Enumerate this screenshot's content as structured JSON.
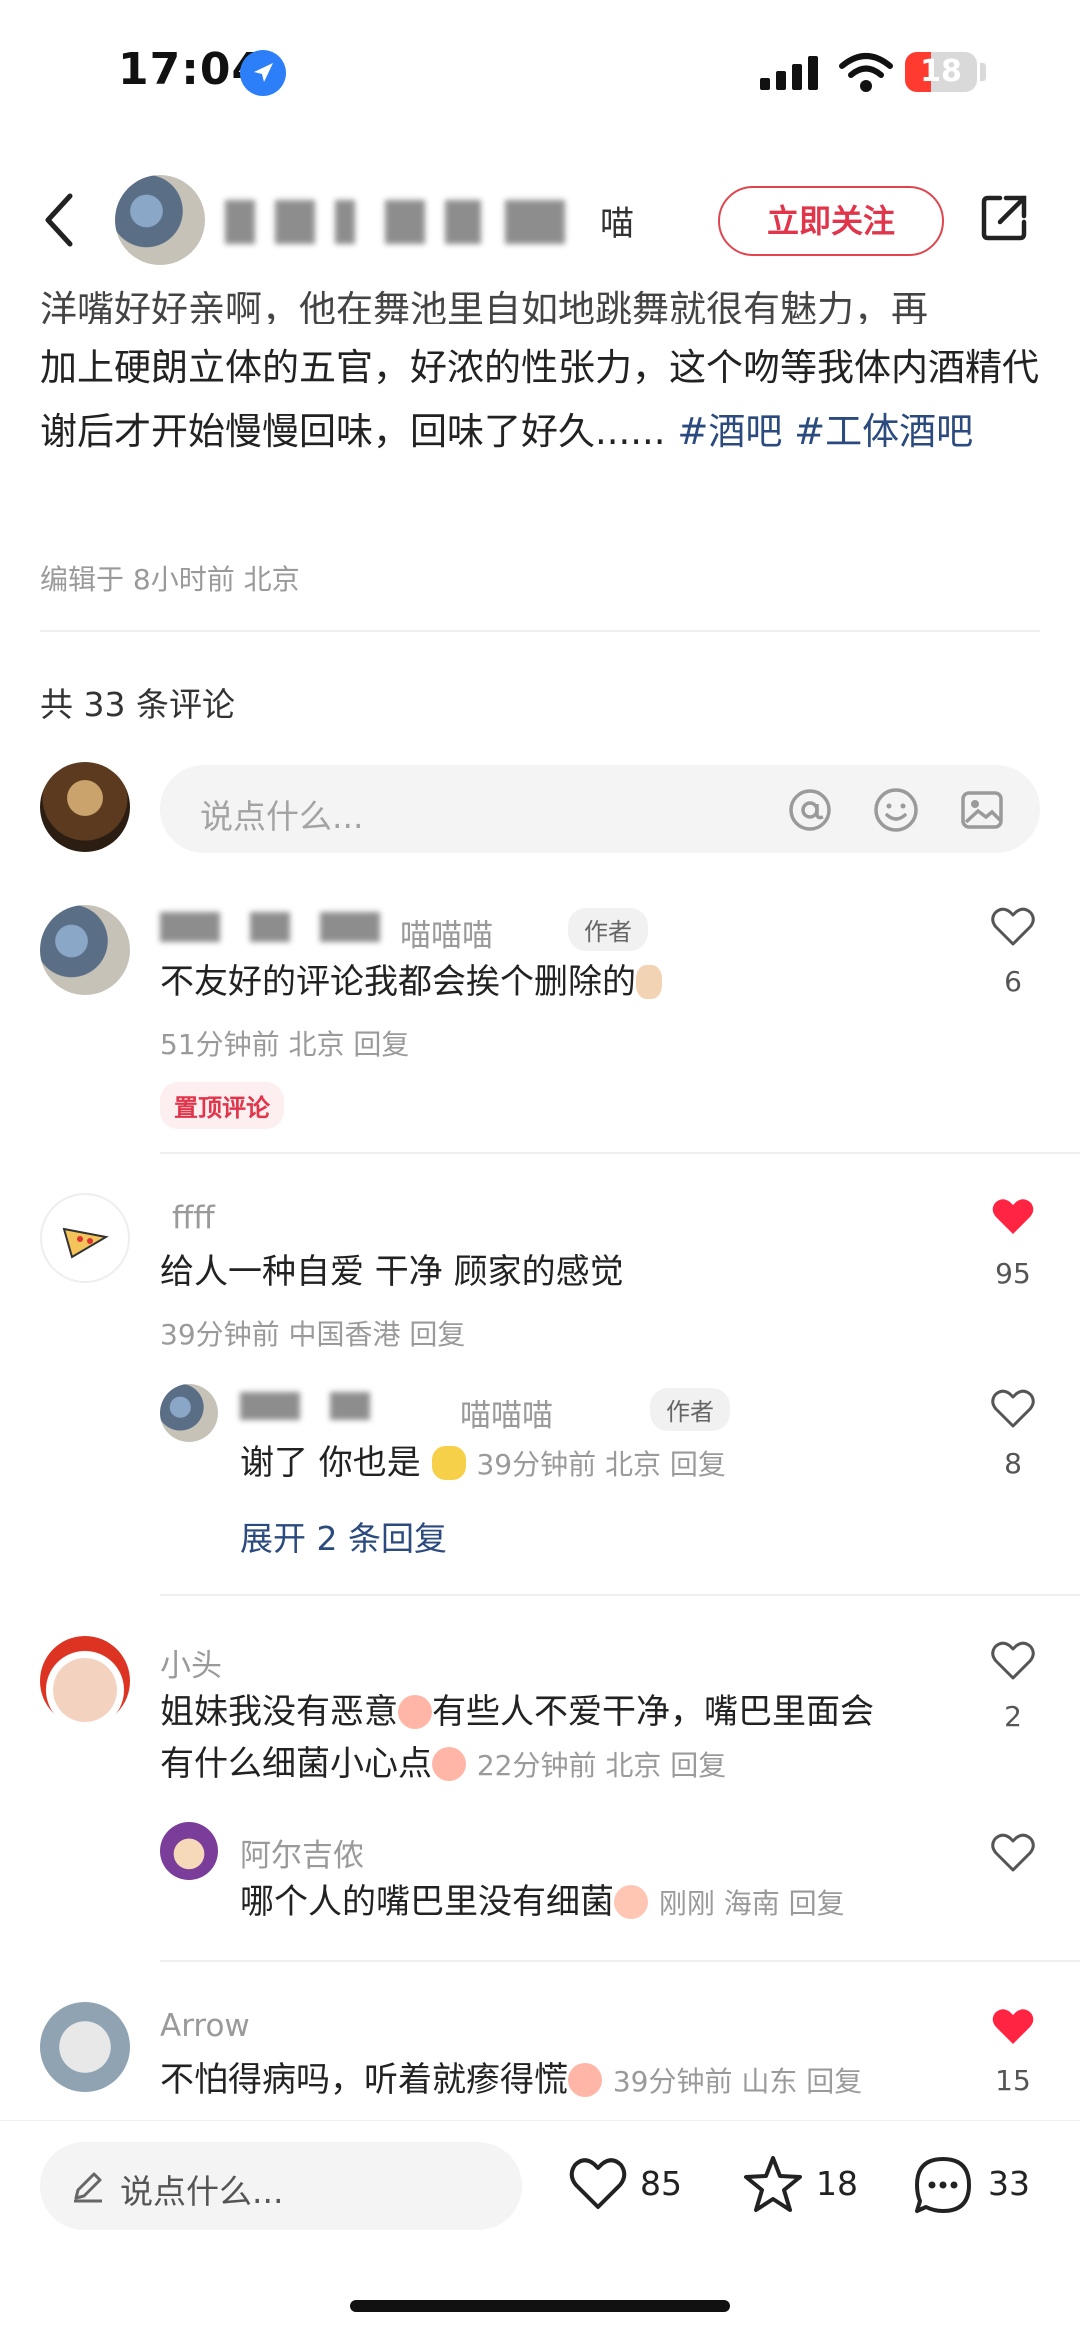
{
  "status_bar": {
    "time": "17:04",
    "battery": "18"
  },
  "header": {
    "name_tail": "喵",
    "follow_label": "立即关注"
  },
  "post": {
    "cut_line": "洋嘴好好亲啊，他在舞池里自如地跳舞就很有魅力，再",
    "line_main": "加上硬朗立体的五官，好浓的性张力，这个吻等我体内酒精代谢后才开始慢慢回味，回味了好久......",
    "tags": [
      "#酒吧",
      "#工体酒吧"
    ],
    "edit_meta": "编辑于 8小时前 北京"
  },
  "comments_count": "共 33 条评论",
  "comment_input": {
    "placeholder": "说点什么..."
  },
  "comments": [
    {
      "name": "喵喵喵",
      "author_tag": "作者",
      "text": "不友好的评论我都会挨个删除的",
      "meta": "51分钟前 北京 回复",
      "pin": "置顶评论",
      "likes": "6",
      "liked": false
    },
    {
      "name": "ffff",
      "text": "给人一种自爱 干净 顾家的感觉",
      "meta": "39分钟前 中国香港 回复",
      "likes": "95",
      "liked": true,
      "reply": {
        "name": "喵喵喵",
        "author_tag": "作者",
        "text": "谢了 你也是",
        "meta": "39分钟前 北京 回复",
        "likes": "8"
      },
      "expand": "展开 2 条回复"
    },
    {
      "name": "小头",
      "text_line1": "姐妹我没有恶意",
      "text_line1b": "有些人不爱干净，嘴巴里面会",
      "text_line2": "有什么细菌小心点",
      "meta": "22分钟前 北京 回复",
      "likes": "2",
      "liked": false,
      "reply": {
        "name": "阿尔吉侬",
        "text": "哪个人的嘴巴里没有细菌",
        "meta": "刚刚 海南 回复"
      }
    },
    {
      "name": "Arrow",
      "text": "不怕得病吗，听着就瘆得慌",
      "meta": "39分钟前 山东 回复",
      "likes": "15",
      "liked": true
    }
  ],
  "bottom_bar": {
    "placeholder": "说点什么...",
    "likes": "85",
    "stars": "18",
    "comments": "33"
  },
  "colors": {
    "accent": "#e0354a",
    "tag": "#2b4a7e",
    "like_red": "#ff2442"
  }
}
